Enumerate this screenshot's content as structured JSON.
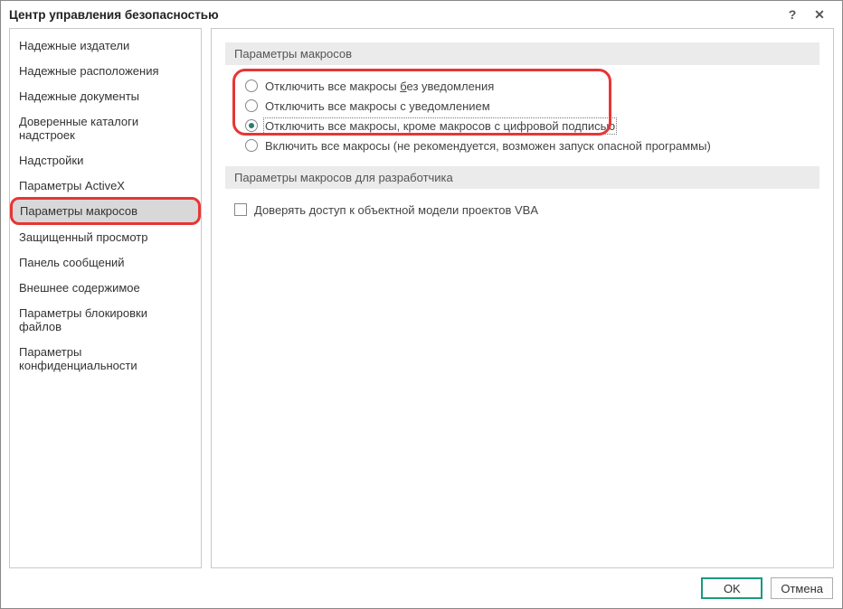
{
  "titlebar": {
    "title": "Центр управления безопасностью",
    "help": "?",
    "close": "✕"
  },
  "sidebar": {
    "items": [
      {
        "label": "Надежные издатели"
      },
      {
        "label": "Надежные расположения"
      },
      {
        "label": "Надежные документы"
      },
      {
        "label": "Доверенные каталоги надстроек"
      },
      {
        "label": "Надстройки"
      },
      {
        "label": "Параметры ActiveX"
      },
      {
        "label": "Параметры макросов",
        "selected": true,
        "highlight": true
      },
      {
        "label": "Защищенный просмотр"
      },
      {
        "label": "Панель сообщений"
      },
      {
        "label": "Внешнее содержимое"
      },
      {
        "label": "Параметры блокировки файлов"
      },
      {
        "label": "Параметры конфиденциальности"
      }
    ]
  },
  "main": {
    "section1": {
      "header": "Параметры макросов",
      "options": [
        {
          "label_pre": "Отключить все макросы ",
          "label_u": "б",
          "label_post": "ез уведомления",
          "checked": false
        },
        {
          "label_pre": "Отключить все макросы с уведомлением",
          "label_u": "",
          "label_post": "",
          "checked": false
        },
        {
          "label_pre": "Отключить все макросы, кроме макросов с цифровой подписью",
          "label_u": "",
          "label_post": "",
          "checked": true,
          "focus": true
        },
        {
          "label_pre": "Включить все макросы (не рекомендуется, возможен запуск опасной программы)",
          "label_u": "",
          "label_post": "",
          "checked": false
        }
      ]
    },
    "section2": {
      "header": "Параметры макросов для разработчика",
      "checkbox": {
        "label": "Доверять доступ к объектной модели проектов VBA",
        "checked": false
      }
    }
  },
  "footer": {
    "ok": "OK",
    "cancel": "Отмена"
  }
}
